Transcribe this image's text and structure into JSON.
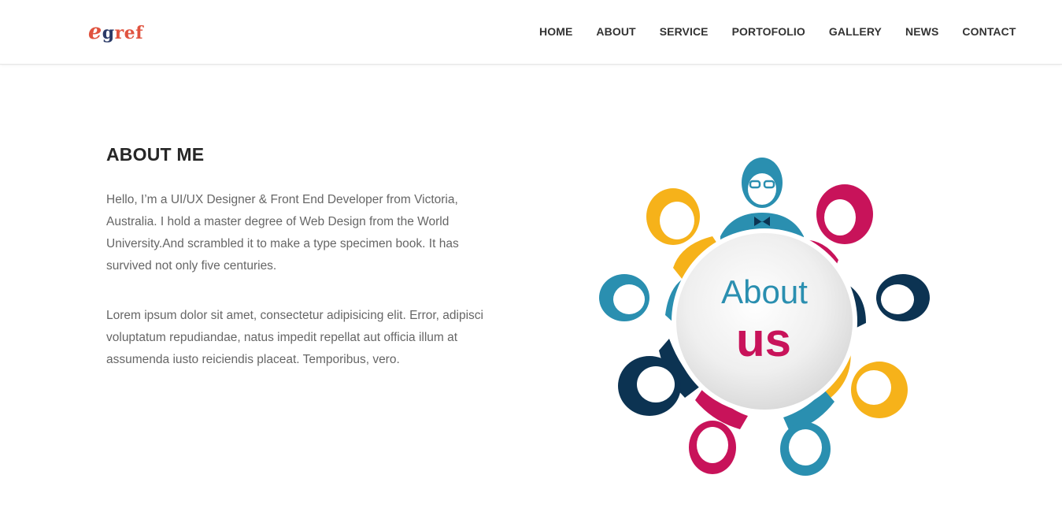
{
  "brand": {
    "logo_e": "e",
    "logo_g": "g",
    "logo_rest": "ref"
  },
  "nav": {
    "items": [
      {
        "label": "HOME"
      },
      {
        "label": "ABOUT"
      },
      {
        "label": "SERVICE"
      },
      {
        "label": "PORTOFOLIO"
      },
      {
        "label": "GALLERY"
      },
      {
        "label": "NEWS"
      },
      {
        "label": "CONTACT"
      }
    ]
  },
  "about": {
    "title": "ABOUT ME",
    "paragraph_1": "Hello, I’m a UI/UX Designer & Front End Developer from Victoria, Australia. I hold a master degree of Web Design from the World University.And scrambled it to make a type specimen book. It has survived not only five centuries.",
    "paragraph_2": "Lorem ipsum dolor sit amet, consectetur adipisicing elit. Error, adipisci voluptatum repudiandae, natus impedit repellat aut officia illum at assumenda iusto reiciendis placeat. Temporibus, vero."
  },
  "illustration": {
    "line_1": "About",
    "line_2": "us"
  },
  "colors": {
    "accent_red": "#e0533f",
    "logo_navy": "#2b3a67",
    "teal": "#2a8fb0",
    "yellow": "#f6b21a",
    "magenta": "#c8135a",
    "navy": "#0c3352"
  }
}
